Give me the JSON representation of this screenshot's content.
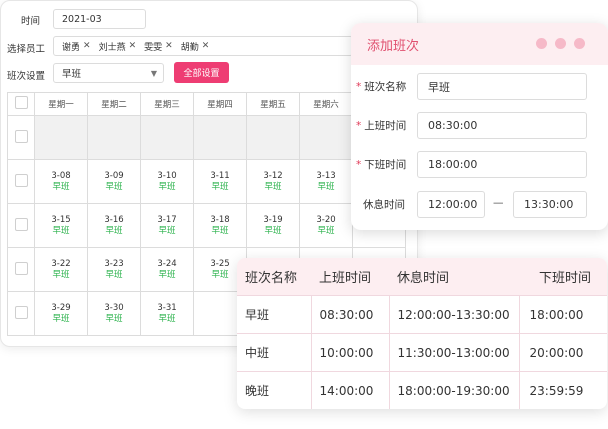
{
  "form": {
    "time_label": "时间",
    "time_value": "2021-03",
    "staff_label": "选择员工",
    "staff_tags": [
      "谢勇",
      "刘士燕",
      "雯雯",
      "胡勤"
    ],
    "shift_setting_label": "班次设置",
    "shift_select_value": "早班",
    "set_all_button": "全部设置"
  },
  "calendar": {
    "weekdays": [
      "星期一",
      "星期二",
      "星期三",
      "星期四",
      "星期五",
      "星期六"
    ],
    "weeks": [
      [
        {
          "date": "3-08",
          "shift": "早班"
        },
        {
          "date": "3-09",
          "shift": "早班"
        },
        {
          "date": "3-10",
          "shift": "早班"
        },
        {
          "date": "3-11",
          "shift": "早班"
        },
        {
          "date": "3-12",
          "shift": "早班"
        },
        {
          "date": "3-13",
          "shift": "早班"
        }
      ],
      [
        {
          "date": "3-15",
          "shift": "早班"
        },
        {
          "date": "3-16",
          "shift": "早班"
        },
        {
          "date": "3-17",
          "shift": "早班"
        },
        {
          "date": "3-18",
          "shift": "早班"
        },
        {
          "date": "3-19",
          "shift": "早班"
        },
        {
          "date": "3-20",
          "shift": "早班"
        }
      ],
      [
        {
          "date": "3-22",
          "shift": "早班"
        },
        {
          "date": "3-23",
          "shift": "早班"
        },
        {
          "date": "3-24",
          "shift": "早班"
        },
        {
          "date": "3-25",
          "shift": "早班"
        },
        {
          "date": "",
          "shift": ""
        },
        {
          "date": "",
          "shift": ""
        }
      ],
      [
        {
          "date": "3-29",
          "shift": "早班"
        },
        {
          "date": "3-30",
          "shift": "早班"
        },
        {
          "date": "3-31",
          "shift": "早班"
        },
        {
          "date": "",
          "shift": ""
        },
        {
          "date": "",
          "shift": ""
        },
        {
          "date": "",
          "shift": ""
        }
      ]
    ]
  },
  "dialog": {
    "title": "添加班次",
    "shift_name_label": "班次名称",
    "shift_name_value": "早班",
    "start_label": "上班时间",
    "start_value": "08:30:00",
    "end_label": "下班时间",
    "end_value": "18:00:00",
    "rest_label": "休息时间",
    "rest_start": "12:00:00",
    "rest_separator": "—",
    "rest_end": "13:30:00",
    "required_mark": "*"
  },
  "shift_table": {
    "headers": [
      "班次名称",
      "上班时间",
      "休息时间",
      "下班时间"
    ],
    "rows": [
      [
        "早班",
        "08:30:00",
        "12:00:00-13:30:00",
        "18:00:00"
      ],
      [
        "中班",
        "10:00:00",
        "11:30:00-13:00:00",
        "20:00:00"
      ],
      [
        "晚班",
        "14:00:00",
        "18:00:00-19:30:00",
        "23:59:59"
      ]
    ]
  },
  "colors": {
    "accent_pink": "#ee3d73",
    "shift_green": "#2bb24c",
    "header_pink_bg": "#fdeef1"
  }
}
